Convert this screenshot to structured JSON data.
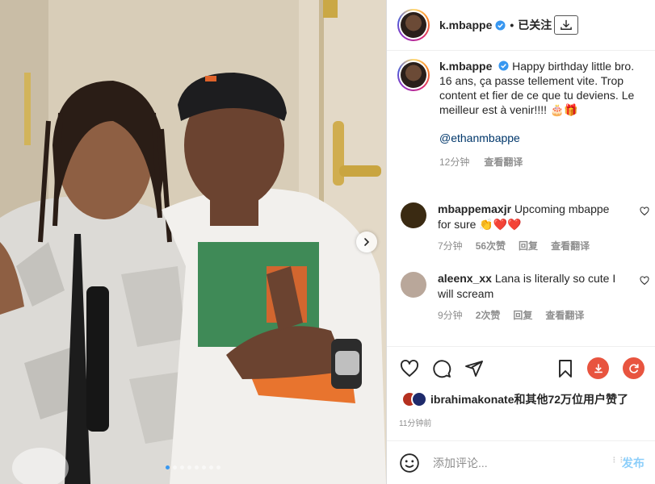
{
  "post": {
    "username": "k.mbappe",
    "follow_state": "已关注",
    "separator": "•"
  },
  "caption": {
    "text": "Happy birthday little bro.\n16 ans, ça passe tellement vite. Trop content et fier de ce que tu deviens. Le meilleur est à venir!!!! 🎂🎁",
    "mention": "@ethanmbappe",
    "time": "12分钟",
    "translate": "查看翻译"
  },
  "comments": [
    {
      "username": "mbappemaxjr",
      "text": "Upcoming mbappe for sure 👏❤️❤️",
      "time": "7分钟",
      "likes": "56次赞",
      "reply": "回复",
      "translate": "查看翻译",
      "avatar_color": "#3a2a12"
    },
    {
      "username": "aleenx_xx",
      "text": "Lana is literally so cute I will scream",
      "time": "9分钟",
      "likes": "2次赞",
      "reply": "回复",
      "translate": "查看翻译",
      "avatar_color": "#b9a79a"
    }
  ],
  "likes": {
    "text": "ibrahimakonate和其他72万位用户赞了"
  },
  "time_ago": "11分钟前",
  "comment_box": {
    "placeholder": "添加评论...",
    "post_label": "发布"
  },
  "icons": {
    "like": "heart-icon",
    "comment": "comment-icon",
    "share": "share-icon",
    "save": "bookmark-icon",
    "download": "download-icon",
    "repost": "repost-icon",
    "emoji": "emoji-icon",
    "verified": "verified-badge-icon",
    "carousel_next": "chevron-right-icon"
  },
  "colors": {
    "accent_blue": "#0095f6",
    "verified_blue": "#3897f0",
    "heart_red": "#ed4956",
    "download_red": "#e8543f"
  },
  "carousel": {
    "total": 8,
    "active": 1
  }
}
